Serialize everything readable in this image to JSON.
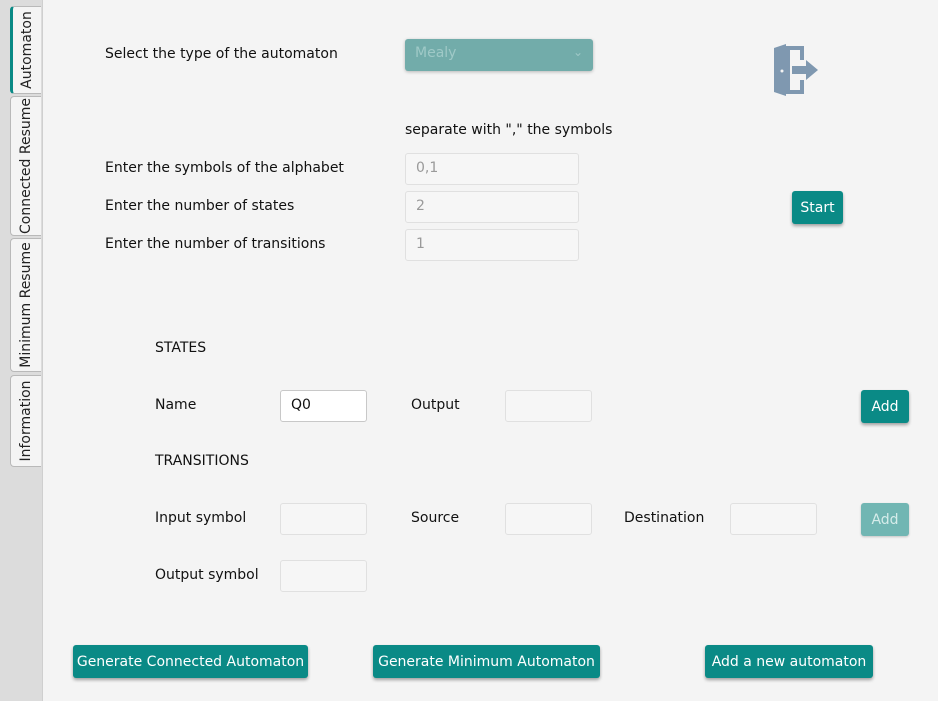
{
  "tabs": [
    "Automaton",
    "Connected Resume",
    "Minimum Resume",
    "Information"
  ],
  "type_label": "Select the type of the automaton",
  "type_value": "Mealy",
  "separator_hint": "separate with \",\" the symbols",
  "alphabet_label": "Enter the symbols of the alphabet",
  "alphabet_placeholder": "0,1",
  "states_count_label": "Enter the number of states",
  "states_count_placeholder": "2",
  "transitions_count_label": "Enter the number of transitions",
  "transitions_count_placeholder": "1",
  "start_button": "Start",
  "states": {
    "title": "STATES",
    "name_label": "Name",
    "name_value": "Q0",
    "output_label": "Output",
    "add_button": "Add"
  },
  "transitions": {
    "title": "TRANSITIONS",
    "input_label": "Input symbol",
    "source_label": "Source",
    "destination_label": "Destination",
    "output_label": "Output symbol",
    "add_button": "Add"
  },
  "bottom": {
    "connected": "Generate Connected Automaton",
    "minimum": "Generate Minimum Automaton",
    "new_automaton": "Add a new automaton"
  },
  "colors": {
    "accent": "#0a8a86",
    "accent_disabled": "#71b6b3",
    "select": "#72acaa",
    "icon": "#7f98b0"
  },
  "icons": {
    "exit": "exit-door-icon",
    "dropdown": "chevron-down-icon"
  }
}
